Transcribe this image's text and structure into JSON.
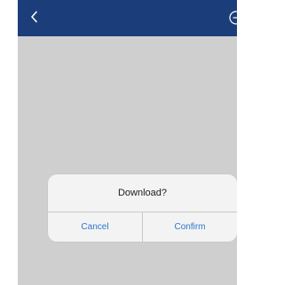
{
  "nav": {
    "back_icon": "chevron-left-icon",
    "right_icon": "circle-action-icon",
    "bar_color": "#1b3e7a"
  },
  "dialog": {
    "title": "Download?",
    "cancel_label": "Cancel",
    "confirm_label": "Confirm",
    "button_color": "#2f74d0"
  }
}
